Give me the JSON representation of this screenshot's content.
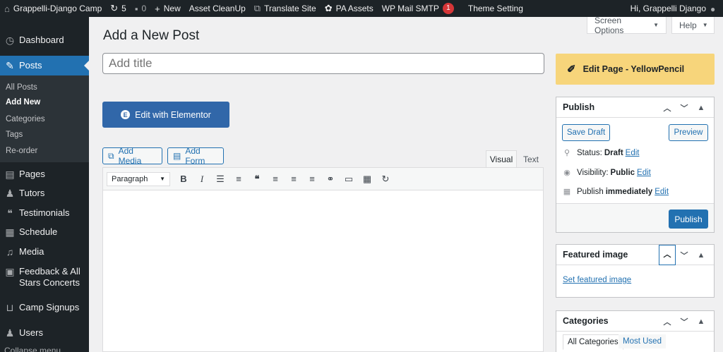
{
  "adminbar": {
    "site_name": "Grappelli-Django Camp",
    "updates_count": "5",
    "comments_count": "0",
    "new_label": "New",
    "asset_cleanup": "Asset CleanUp",
    "translate_site": "Translate Site",
    "pa_assets": "PA Assets",
    "wp_mail_smtp": "WP Mail SMTP",
    "wp_mail_smtp_badge": "1",
    "theme_setting": "Theme Setting",
    "greeting": "Hi, Grappelli Django"
  },
  "sidebar": {
    "dashboard": "Dashboard",
    "posts": "Posts",
    "submenu": [
      "All Posts",
      "Add New",
      "Categories",
      "Tags",
      "Re-order"
    ],
    "pages": "Pages",
    "tutors": "Tutors",
    "testimonials": "Testimonials",
    "schedule": "Schedule",
    "media": "Media",
    "feedback_line1": "Feedback & All",
    "feedback_line2": "Stars Concerts",
    "camp_signups": "Camp Signups",
    "users": "Users",
    "collapse": "Collapse menu"
  },
  "header": {
    "screen_options": "Screen Options",
    "help": "Help",
    "page_title": "Add a New Post"
  },
  "editor": {
    "title_placeholder": "Add title",
    "elementor_button": "Edit with Elementor",
    "add_media": "Add Media",
    "add_form": "Add Form",
    "tab_visual": "Visual",
    "tab_text": "Text",
    "format_select": "Paragraph"
  },
  "sidebar_right": {
    "yellowpencil": "Edit Page - YellowPencil",
    "publish": {
      "title": "Publish",
      "save_draft": "Save Draft",
      "preview": "Preview",
      "status_label": "Status:",
      "status_value": "Draft",
      "visibility_label": "Visibility:",
      "visibility_value": "Public",
      "publish_label": "Publish",
      "publish_value": "immediately",
      "edit_link": "Edit",
      "publish_button": "Publish"
    },
    "featured_image": {
      "title": "Featured image",
      "set_link": "Set featured image"
    },
    "categories": {
      "title": "Categories",
      "tab_all": "All Categories",
      "tab_most_used": "Most Used"
    }
  }
}
